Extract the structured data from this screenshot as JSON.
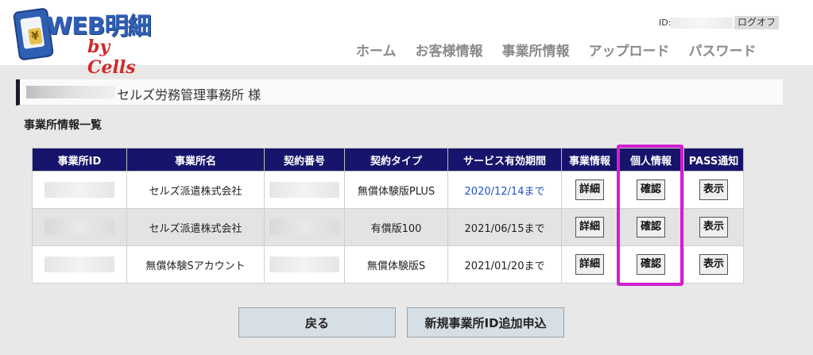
{
  "header": {
    "logo_main": "WEB明細",
    "logo_sub": "by Cells",
    "logo_glyph": "¥",
    "user_id_label": "ID:",
    "logout_label": "ログオフ",
    "nav": [
      "ホーム",
      "お客様情報",
      "事業所情報",
      "アップロード",
      "パスワード"
    ]
  },
  "page": {
    "company_suffix": "セルズ労務管理事務所 様",
    "section_title": "事業所情報一覧"
  },
  "table": {
    "headers": [
      "事業所ID",
      "事業所名",
      "契約番号",
      "契約タイプ",
      "サービス有効期間",
      "事業情報",
      "個人情報",
      "PASS通知"
    ],
    "rows": [
      {
        "name": "セルズ派遣株式会社",
        "type": "無償体験版PLUS",
        "period": "2020/12/14まで",
        "detail": "詳細",
        "confirm": "確認",
        "show": "表示"
      },
      {
        "name": "セルズ派遣株式会社",
        "type": "有償版100",
        "period": "2021/06/15まで",
        "detail": "詳細",
        "confirm": "確認",
        "show": "表示"
      },
      {
        "name": "無償体験Sアカウント",
        "type": "無償体験版S",
        "period": "2021/01/20まで",
        "detail": "詳細",
        "confirm": "確認",
        "show": "表示"
      }
    ]
  },
  "buttons": {
    "back": "戻る",
    "new_office": "新規事業所ID追加申込"
  },
  "colors": {
    "header_bg": "#17146b",
    "highlight": "#d21fd1",
    "date_blue": "#2450c8"
  }
}
